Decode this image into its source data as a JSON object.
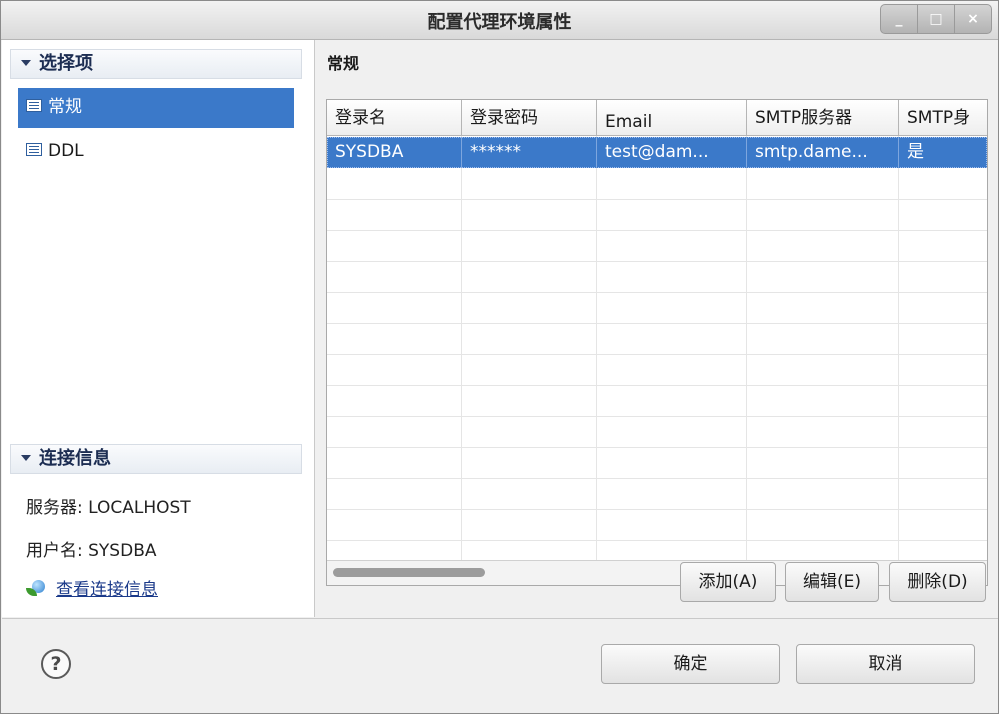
{
  "window": {
    "title": "配置代理环境属性",
    "minimize": "_",
    "maximize": "□",
    "close": "×"
  },
  "sidebar": {
    "section_title": "选择项",
    "items": [
      {
        "label": "常规",
        "selected": true
      },
      {
        "label": "DDL",
        "selected": false
      }
    ]
  },
  "connection": {
    "section_title": "连接信息",
    "server": "服务器: LOCALHOST",
    "user": "用户名: SYSDBA",
    "link": "查看连接信息"
  },
  "main": {
    "title": "常规",
    "table": {
      "columns": [
        "登录名",
        "登录密码",
        "Email",
        "SMTP服务器",
        "SMTP身"
      ],
      "rows": [
        [
          "SYSDBA",
          "******",
          "test@dam...",
          "smtp.dame...",
          "是"
        ]
      ]
    },
    "buttons": {
      "add": "添加(A)",
      "edit": "编辑(E)",
      "delete": "删除(D)"
    }
  },
  "footer": {
    "help": "?",
    "ok": "确定",
    "cancel": "取消"
  }
}
